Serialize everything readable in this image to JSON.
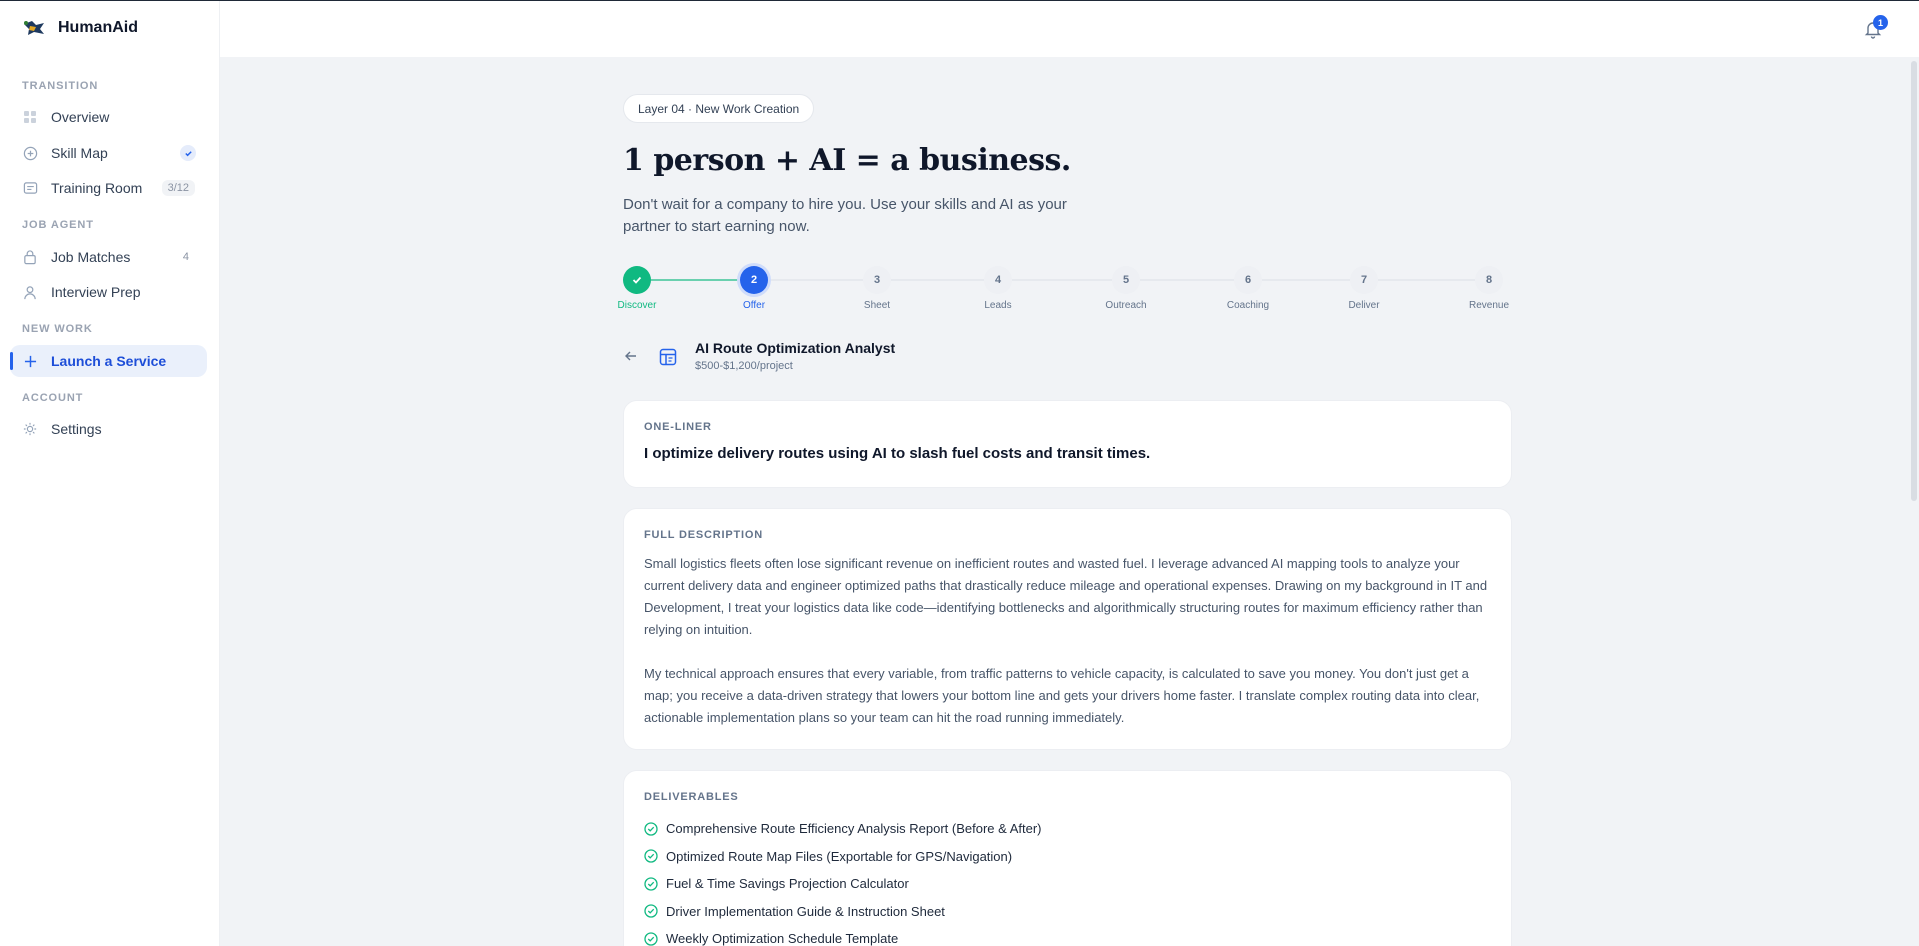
{
  "app": {
    "name": "HumanAid"
  },
  "sidebar": {
    "sections": [
      {
        "label": "TRANSITION",
        "items": [
          {
            "label": "Overview",
            "icon": "grid-icon"
          },
          {
            "label": "Skill Map",
            "icon": "compass-icon",
            "status": "check"
          },
          {
            "label": "Training Room",
            "icon": "book-icon",
            "badge": "3/12"
          }
        ]
      },
      {
        "label": "JOB AGENT",
        "items": [
          {
            "label": "Job Matches",
            "icon": "briefcase-icon",
            "badge": "4"
          },
          {
            "label": "Interview Prep",
            "icon": "user-icon"
          }
        ]
      },
      {
        "label": "NEW WORK",
        "items": [
          {
            "label": "Launch a Service",
            "icon": "plus-icon",
            "active": true
          }
        ]
      },
      {
        "label": "ACCOUNT",
        "items": [
          {
            "label": "Settings",
            "icon": "sun-gear-icon"
          }
        ]
      }
    ]
  },
  "topbar": {
    "notifications": "1"
  },
  "hero": {
    "pill": "Layer 04 · New Work Creation",
    "title": "1 person + AI = a business.",
    "subtitle": "Don't wait for a company to hire you. Use your skills and AI as your partner to start earning now."
  },
  "stepper": {
    "steps": [
      {
        "num": "1",
        "label": "Discover",
        "state": "done"
      },
      {
        "num": "2",
        "label": "Offer",
        "state": "current"
      },
      {
        "num": "3",
        "label": "Sheet",
        "state": "todo"
      },
      {
        "num": "4",
        "label": "Leads",
        "state": "todo"
      },
      {
        "num": "5",
        "label": "Outreach",
        "state": "todo"
      },
      {
        "num": "6",
        "label": "Coaching",
        "state": "todo"
      },
      {
        "num": "7",
        "label": "Deliver",
        "state": "todo"
      },
      {
        "num": "8",
        "label": "Revenue",
        "state": "todo"
      }
    ]
  },
  "service": {
    "title": "AI Route Optimization Analyst",
    "price": "$500-$1,200/project"
  },
  "one_liner": {
    "label": "ONE-LINER",
    "text": "I optimize delivery routes using AI to slash fuel costs and transit times."
  },
  "description": {
    "label": "FULL DESCRIPTION",
    "paragraphs": [
      "Small logistics fleets often lose significant revenue on inefficient routes and wasted fuel. I leverage advanced AI mapping tools to analyze your current delivery data and engineer optimized paths that drastically reduce mileage and operational expenses. Drawing on my background in IT and Development, I treat your logistics data like code—identifying bottlenecks and algorithmically structuring routes for maximum efficiency rather than relying on intuition.",
      "My technical approach ensures that every variable, from traffic patterns to vehicle capacity, is calculated to save you money. You don't just get a map; you receive a data-driven strategy that lowers your bottom line and gets your drivers home faster. I translate complex routing data into clear, actionable implementation plans so your team can hit the road running immediately."
    ]
  },
  "deliverables": {
    "label": "DELIVERABLES",
    "items": [
      "Comprehensive Route Efficiency Analysis Report (Before & After)",
      "Optimized Route Map Files (Exportable for GPS/Navigation)",
      "Fuel & Time Savings Projection Calculator",
      "Driver Implementation Guide & Instruction Sheet",
      "Weekly Optimization Schedule Template"
    ]
  },
  "colors": {
    "accent": "#2563eb",
    "success": "#10b981"
  }
}
